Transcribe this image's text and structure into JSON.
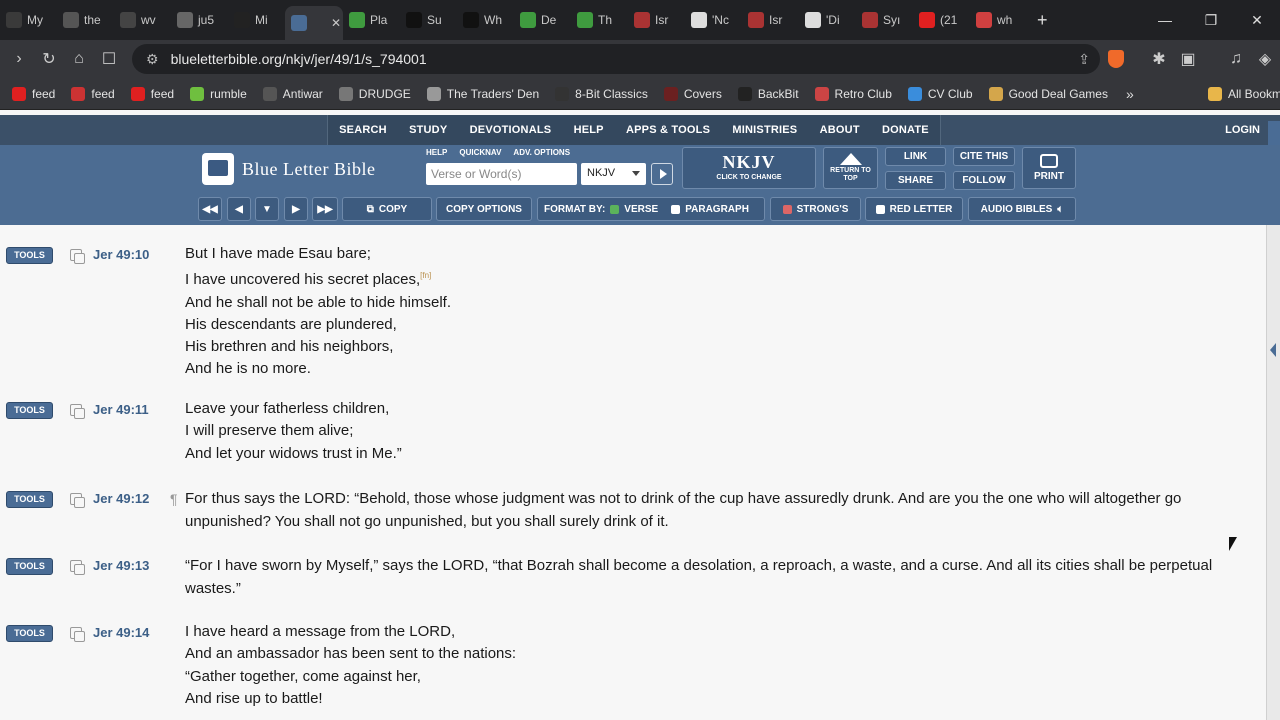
{
  "browser": {
    "tabs": [
      {
        "label": "My",
        "color": "#3a3a3a"
      },
      {
        "label": "the",
        "color": "#555555"
      },
      {
        "label": "wv",
        "color": "#444444"
      },
      {
        "label": "ju5",
        "color": "#666666"
      },
      {
        "label": "Mi",
        "color": "#222222"
      },
      {
        "label": "",
        "color": "#4a6c95",
        "active": true
      },
      {
        "label": "Pla",
        "color": "#3f9b3f"
      },
      {
        "label": "Su",
        "color": "#111111"
      },
      {
        "label": "Wh",
        "color": "#111111"
      },
      {
        "label": "De",
        "color": "#3f9b3f"
      },
      {
        "label": "Th",
        "color": "#3f9b3f"
      },
      {
        "label": "Isr",
        "color": "#a33"
      },
      {
        "label": "'Nc",
        "color": "#ddd"
      },
      {
        "label": "Isr",
        "color": "#a33"
      },
      {
        "label": "'Di",
        "color": "#ddd"
      },
      {
        "label": "Syı",
        "color": "#a33"
      },
      {
        "label": "(21",
        "color": "#e02020"
      },
      {
        "label": "wh",
        "color": "#d04040"
      }
    ],
    "close_glyph": "✕",
    "new_tab_glyph": "+",
    "url": "blueletterbible.org/nkjv/jer/49/1/s_794001",
    "bookmarks": [
      {
        "label": "feed",
        "color": "#e02020"
      },
      {
        "label": "feed",
        "color": "#cc3333"
      },
      {
        "label": "feed",
        "color": "#e02020"
      },
      {
        "label": "rumble",
        "color": "#6fbf3f"
      },
      {
        "label": "Antiwar",
        "color": "#555555"
      },
      {
        "label": "DRUDGE",
        "color": "#777777"
      },
      {
        "label": "The Traders' Den",
        "color": "#999999"
      },
      {
        "label": "8-Bit Classics",
        "color": "#333333"
      },
      {
        "label": "Covers",
        "color": "#6b2020"
      },
      {
        "label": "BackBit",
        "color": "#222222"
      },
      {
        "label": "Retro Club",
        "color": "#c44"
      },
      {
        "label": "CV Club",
        "color": "#3a8ddc"
      },
      {
        "label": "Good Deal Games",
        "color": "#d4a64b"
      }
    ],
    "bookmarks_more": "»",
    "all_bookmarks": "All Bookm"
  },
  "site": {
    "topnav": [
      "SEARCH",
      "STUDY",
      "DEVOTIONALS",
      "HELP",
      "APPS & TOOLS",
      "MINISTRIES",
      "ABOUT",
      "DONATE"
    ],
    "login": "LOGIN",
    "logo_text": "Blue Letter Bible",
    "minilinks": [
      "HELP",
      "QUICKNAV",
      "ADV. OPTIONS"
    ],
    "search_placeholder": "Verse or Word(s)",
    "version": "NKJV",
    "version_big": "NKJV",
    "version_small": "CLICK TO CHANGE",
    "return_top": "RETURN TO TOP",
    "link": "LINK",
    "share": "SHARE",
    "cite": "CITE THIS",
    "follow": "FOLLOW",
    "print": "PRINT",
    "toolbar": {
      "copy": "COPY",
      "copy_options": "COPY OPTIONS",
      "format_by": "FORMAT BY:",
      "verse": "VERSE",
      "paragraph": "PARAGRAPH",
      "strongs": "STRONG'S",
      "red_letter": "RED LETTER",
      "audio": "AUDIO BIBLES"
    }
  },
  "verses": [
    {
      "tools": "TOOLS",
      "ref": "Jer 49:10",
      "lines": [
        "But I have made Esau bare;",
        "I have uncovered his secret places,",
        "And he shall not be able to hide himself.",
        "His descendants are plundered,",
        "His brethren and his neighbors,",
        "And he is no more."
      ],
      "footnote": "[fn]"
    },
    {
      "tools": "TOOLS",
      "ref": "Jer 49:11",
      "lines": [
        "Leave your fatherless children,",
        "I will preserve them alive;",
        "And let your widows trust in Me.”"
      ]
    },
    {
      "tools": "TOOLS",
      "ref": "Jer 49:12",
      "pilcrow": "¶",
      "text": "For thus says the LORD: “Behold, those whose judgment was not to drink of the cup have assuredly drunk. And are you the one who will altogether go unpunished? You shall not go unpunished, but you shall surely drink of it."
    },
    {
      "tools": "TOOLS",
      "ref": "Jer 49:13",
      "text": "“For I have sworn by Myself,” says the LORD, “that Bozrah shall become a desolation, a reproach, a waste, and a curse. And all its cities shall be perpetual wastes.”"
    },
    {
      "tools": "TOOLS",
      "ref": "Jer 49:14",
      "lines": [
        "I have heard a message from the LORD,",
        "And an ambassador has been sent to the nations:",
        "“Gather together, come against her,",
        "And rise up to battle!"
      ]
    }
  ]
}
